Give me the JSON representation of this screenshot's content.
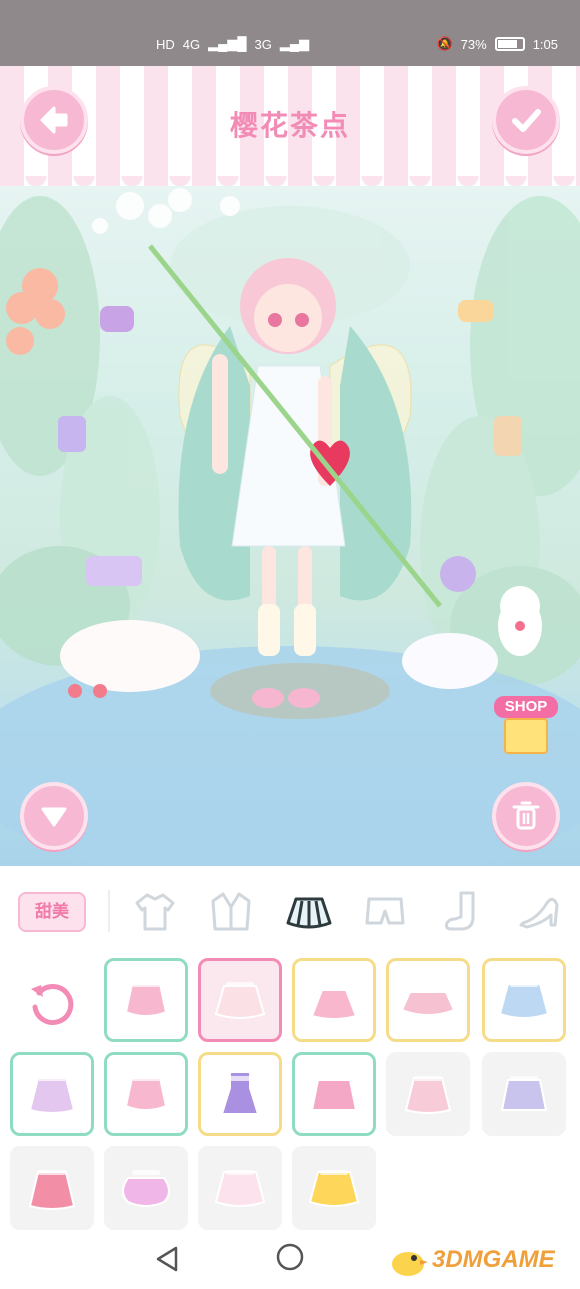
{
  "status_bar": {
    "left_items": [
      "HD",
      "4G",
      "3G"
    ],
    "battery_percent": "73%",
    "time": "1:05"
  },
  "header": {
    "title": "樱花茶点",
    "back_icon": "arrow-left-icon",
    "confirm_icon": "check-icon"
  },
  "scene": {
    "shop_label": "SHOP"
  },
  "category_bar": {
    "style_label": "甜美",
    "categories": [
      "top",
      "jacket",
      "skirt",
      "shorts",
      "socks",
      "shoes"
    ],
    "selected_category": "skirt"
  },
  "items": [
    {
      "kind": "ruffle-skirt",
      "color": "#f7b7cf",
      "frame": "green"
    },
    {
      "kind": "floral-skirt",
      "color": "#fbe0e6",
      "frame": "pink"
    },
    {
      "kind": "suspender-tutu",
      "color": "#f8b7cc",
      "frame": "yellow"
    },
    {
      "kind": "puffy-skirt",
      "color": "#f6c1d0",
      "frame": "yellow"
    },
    {
      "kind": "tiered-skirt",
      "color": "#bcd8f3",
      "frame": "yellow"
    },
    {
      "kind": "pleated-skirt",
      "color": "#e3c7ef",
      "frame": "green"
    },
    {
      "kind": "ruffle-skirt",
      "color": "#f7b7cf",
      "frame": "green"
    },
    {
      "kind": "overall-dress",
      "color": "#a990e0",
      "frame": "yellow"
    },
    {
      "kind": "plaid-skirt",
      "color": "#f4a8c6",
      "frame": "green"
    },
    {
      "kind": "pleated-skirt",
      "color": "#f8cbd9",
      "frame": "none"
    },
    {
      "kind": "plaid-skirt",
      "color": "#c9c4ee",
      "frame": "none"
    },
    {
      "kind": "polka-skirt",
      "color": "#f28fa6",
      "frame": "none"
    },
    {
      "kind": "bubble-skirt",
      "color": "#f1b6e8",
      "frame": "none"
    },
    {
      "kind": "tiered-skirt",
      "color": "#fce2ec",
      "frame": "none"
    },
    {
      "kind": "tiered-skirt",
      "color": "#fdd65a",
      "frame": "none"
    }
  ],
  "watermark": {
    "text": "3DMGAME"
  }
}
